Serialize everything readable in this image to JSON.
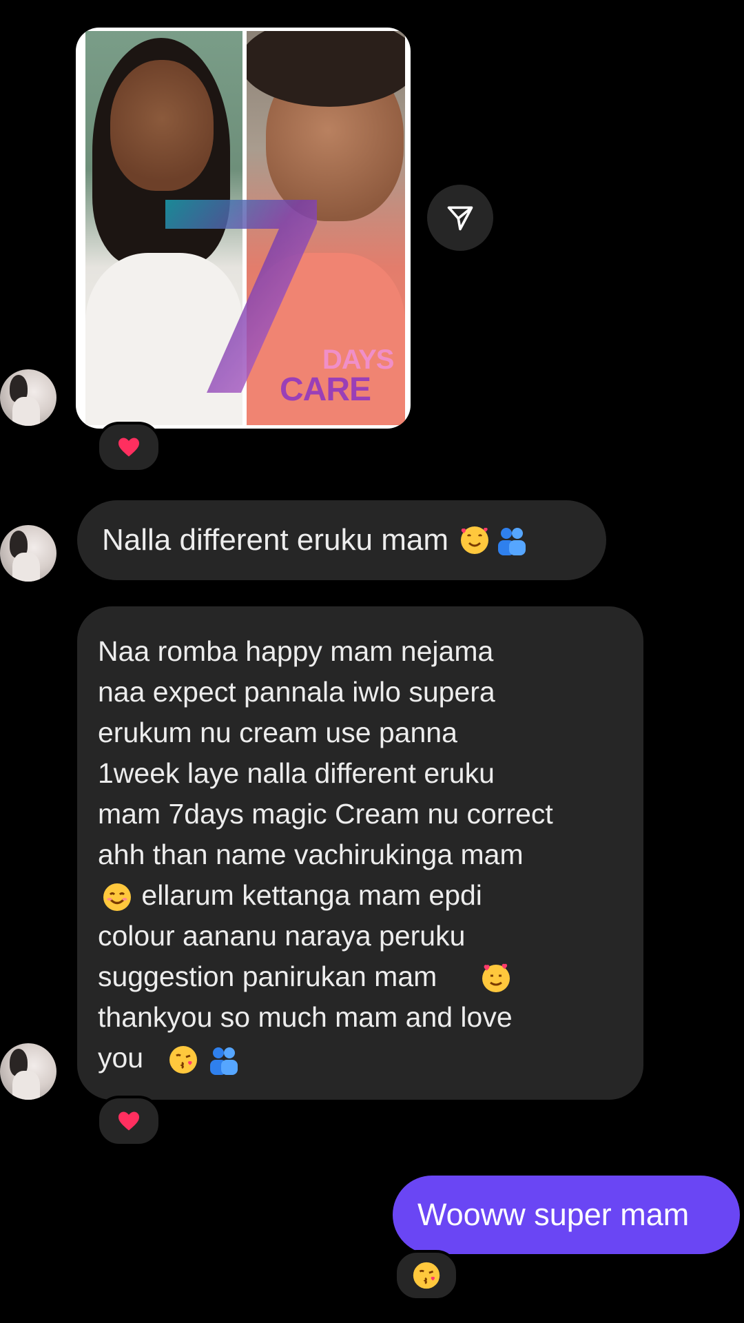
{
  "conversation": {
    "shared_post": {
      "image_description_tags": [
        "before-after-photo"
      ],
      "logo_text": {
        "top": "DAYS",
        "bottom": "CARE"
      },
      "reaction": "heart"
    },
    "messages": [
      {
        "sender": "them",
        "text": "Nalla different eruku mam",
        "emojis": [
          "smiling-face-with-hearts",
          "two-people-hugging"
        ]
      },
      {
        "sender": "them",
        "lines": [
          "Naa romba happy mam nejama",
          "naa expect pannala iwlo supera",
          "erukum nu cream use panna",
          "1week laye nalla different eruku",
          "mam 7days magic Cream nu correct",
          "ahh than name vachirukinga mam",
          " ellarum kettanga mam epdi",
          "colour aananu naraya peruku",
          "suggestion panirukan mam",
          "thankyou so much mam and love",
          "you"
        ],
        "reaction": "heart"
      },
      {
        "sender": "me",
        "text": "Wooww super mam",
        "reaction": "face-blowing-a-kiss"
      }
    ]
  },
  "colors": {
    "background": "#000000",
    "their_bubble": "#262626",
    "my_bubble": "#6a46f4",
    "heart": "#ff2f5f"
  },
  "icons": {
    "share": "send-paper-plane-icon"
  }
}
